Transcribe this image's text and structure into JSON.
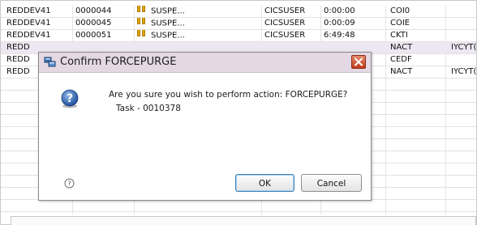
{
  "table": {
    "rows": [
      {
        "region": "REDDEV41",
        "task": "0000044",
        "status": "SUSPE...",
        "user": "CICSUSER",
        "time": "0:00:00",
        "tran": "COI0",
        "extra": ""
      },
      {
        "region": "REDDEV41",
        "task": "0000045",
        "status": "SUSPE...",
        "user": "CICSUSER",
        "time": "0:00:09",
        "tran": "COIE",
        "extra": ""
      },
      {
        "region": "REDDEV41",
        "task": "0000051",
        "status": "SUSPE...",
        "user": "CICSUSER",
        "time": "6:49:48",
        "tran": "CKTI",
        "extra": ""
      },
      {
        "region": "REDD",
        "task": "",
        "status": "",
        "user": "",
        "time": "",
        "tran": "NACT",
        "extra": "IYCYT("
      },
      {
        "region": "REDD",
        "task": "",
        "status": "",
        "user": "",
        "time": "",
        "tran": "CEDF",
        "extra": ""
      },
      {
        "region": "REDD",
        "task": "",
        "status": "",
        "user": "",
        "time": "",
        "tran": "NACT",
        "extra": "IYCYT("
      }
    ]
  },
  "dialog": {
    "title": "Confirm FORCEPURGE",
    "message": "Are you sure you wish to perform action: FORCEPURGE?",
    "detail": "Task - 0010378",
    "ok_label": "OK",
    "cancel_label": "Cancel",
    "icon": "question-icon",
    "help_icon": "help-icon"
  }
}
